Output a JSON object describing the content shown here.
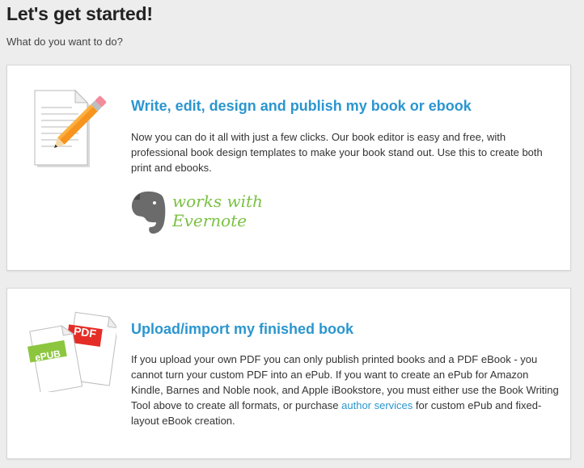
{
  "header": {
    "title": "Let's get started!",
    "subtitle": "What do you want to do?"
  },
  "options": [
    {
      "title": "Write, edit, design and publish my book or ebook",
      "description": "Now you can do it all with just a few clicks. Our book editor is easy and free, with professional book design templates to make your book stand out. Use this to create both print and ebooks.",
      "icon": "document-pencil-icon",
      "badge": {
        "icon": "evernote-elephant-icon",
        "line1": "works with",
        "line2": "Evernote"
      }
    },
    {
      "title": "Upload/import my finished book",
      "description_before_link": "If you upload your own PDF you can only publish printed books and a PDF eBook - you cannot turn your custom PDF into an ePub. If you want to create an ePub for Amazon Kindle, Barnes and Noble nook, and Apple iBookstore, you must either use the Book Writing Tool above to create all formats, or purchase ",
      "link_text": "author services",
      "description_after_link": " for custom ePub and fixed-layout eBook creation.",
      "icon": "epub-pdf-files-icon",
      "file_labels": {
        "epub": "ePUB",
        "pdf": "PDF"
      }
    }
  ],
  "colors": {
    "accent": "#2b96cf",
    "evernote_green": "#7ac142",
    "epub_green": "#8cc63f",
    "pdf_red": "#e52d27"
  }
}
